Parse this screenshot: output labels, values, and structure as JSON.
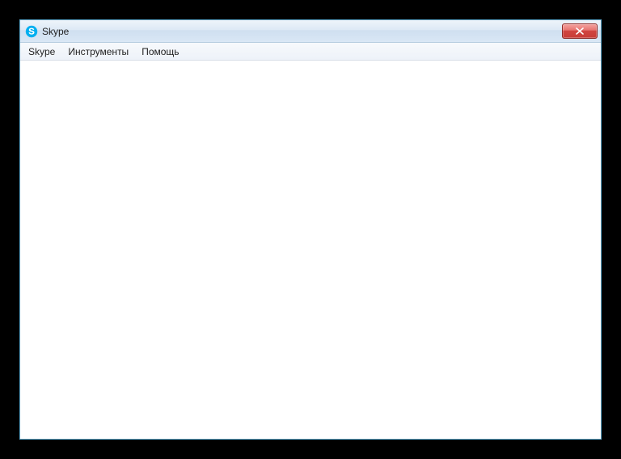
{
  "window": {
    "title": "Skype"
  },
  "menubar": {
    "items": [
      {
        "label": "Skype"
      },
      {
        "label": "Инструменты"
      },
      {
        "label": "Помощь"
      }
    ]
  }
}
